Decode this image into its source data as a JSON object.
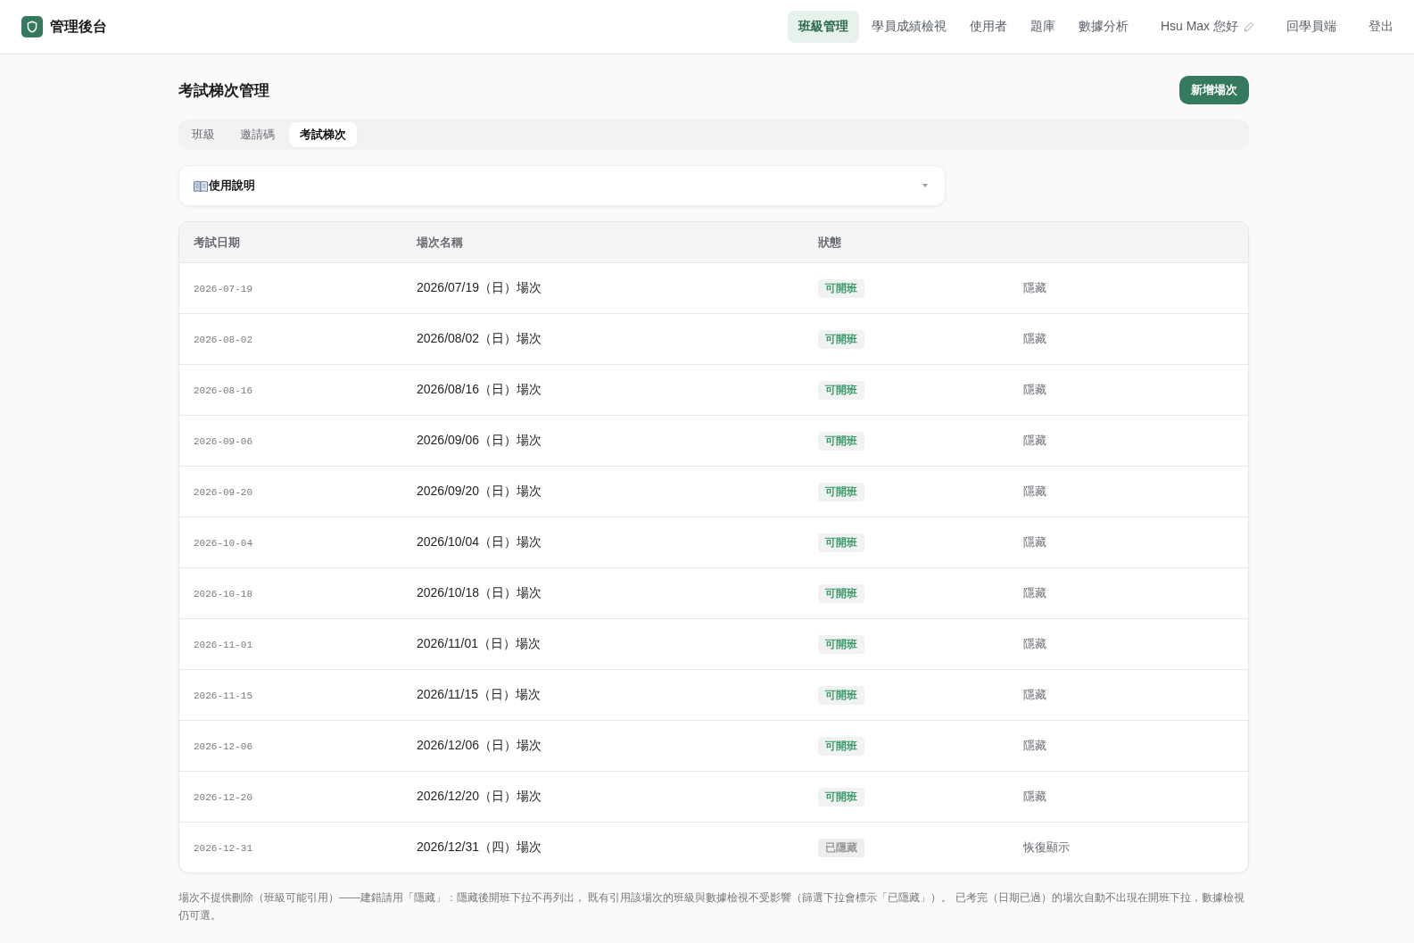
{
  "app": {
    "title": "管理後台"
  },
  "nav": [
    {
      "label": "班級管理",
      "selected": true
    },
    {
      "label": "學員成績檢視",
      "selected": false
    },
    {
      "label": "使用者",
      "selected": false
    },
    {
      "label": "題庫",
      "selected": false
    },
    {
      "label": "數據分析",
      "selected": false
    }
  ],
  "user": {
    "greeting": "Hsu Max 您好"
  },
  "header_links": [
    "回學員端",
    "登出"
  ],
  "page": {
    "title": "考試梯次管理",
    "primary_button": "新增場次"
  },
  "tabs": [
    {
      "label": "班級",
      "selected": false
    },
    {
      "label": "邀請碼",
      "selected": false
    },
    {
      "label": "考試梯次",
      "selected": true
    }
  ],
  "help": {
    "label": "使用說明",
    "expanded": false
  },
  "table": {
    "columns": [
      "考試日期",
      "場次名稱",
      "狀態"
    ],
    "rows": [
      {
        "date": "2026-07-19",
        "name": "2026/07/19（日）場次",
        "status": "可開班",
        "hidden": false,
        "action": "隱藏"
      },
      {
        "date": "2026-08-02",
        "name": "2026/08/02（日）場次",
        "status": "可開班",
        "hidden": false,
        "action": "隱藏"
      },
      {
        "date": "2026-08-16",
        "name": "2026/08/16（日）場次",
        "status": "可開班",
        "hidden": false,
        "action": "隱藏"
      },
      {
        "date": "2026-09-06",
        "name": "2026/09/06（日）場次",
        "status": "可開班",
        "hidden": false,
        "action": "隱藏"
      },
      {
        "date": "2026-09-20",
        "name": "2026/09/20（日）場次",
        "status": "可開班",
        "hidden": false,
        "action": "隱藏"
      },
      {
        "date": "2026-10-04",
        "name": "2026/10/04（日）場次",
        "status": "可開班",
        "hidden": false,
        "action": "隱藏"
      },
      {
        "date": "2026-10-18",
        "name": "2026/10/18（日）場次",
        "status": "可開班",
        "hidden": false,
        "action": "隱藏"
      },
      {
        "date": "2026-11-01",
        "name": "2026/11/01（日）場次",
        "status": "可開班",
        "hidden": false,
        "action": "隱藏"
      },
      {
        "date": "2026-11-15",
        "name": "2026/11/15（日）場次",
        "status": "可開班",
        "hidden": false,
        "action": "隱藏"
      },
      {
        "date": "2026-12-06",
        "name": "2026/12/06（日）場次",
        "status": "可開班",
        "hidden": false,
        "action": "隱藏"
      },
      {
        "date": "2026-12-20",
        "name": "2026/12/20（日）場次",
        "status": "可開班",
        "hidden": false,
        "action": "隱藏"
      },
      {
        "date": "2026-12-31",
        "name": "2026/12/31（四）場次",
        "status": "已隱藏",
        "hidden": true,
        "action": "恢復顯示"
      }
    ]
  },
  "note": "場次不提供刪除（班級可能引用）——建錯請用「隱藏」：隱藏後開班下拉不再列出， 既有引用該場次的班級與數據檢視不受影響（篩選下拉會標示「已隱藏」）。 已考完（日期已過）的場次自動不出現在開班下拉，數據檢視仍可選。"
}
